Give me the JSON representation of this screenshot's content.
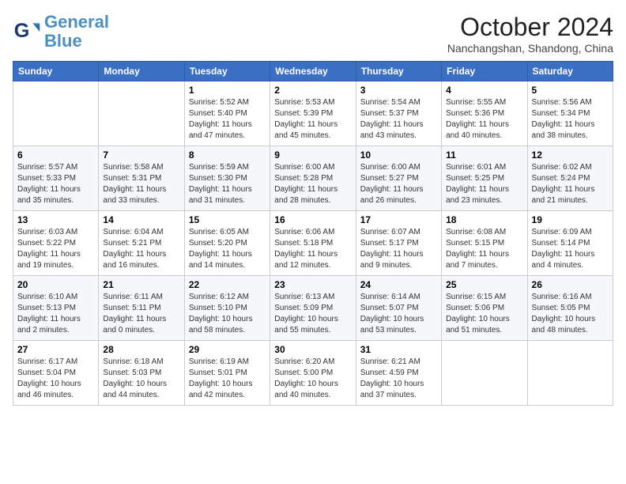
{
  "header": {
    "logo_line1": "General",
    "logo_line2": "Blue",
    "month_title": "October 2024",
    "location": "Nanchangshan, Shandong, China"
  },
  "days_of_week": [
    "Sunday",
    "Monday",
    "Tuesday",
    "Wednesday",
    "Thursday",
    "Friday",
    "Saturday"
  ],
  "weeks": [
    [
      {
        "day": "",
        "info": ""
      },
      {
        "day": "",
        "info": ""
      },
      {
        "day": "1",
        "info": "Sunrise: 5:52 AM\nSunset: 5:40 PM\nDaylight: 11 hours and 47 minutes."
      },
      {
        "day": "2",
        "info": "Sunrise: 5:53 AM\nSunset: 5:39 PM\nDaylight: 11 hours and 45 minutes."
      },
      {
        "day": "3",
        "info": "Sunrise: 5:54 AM\nSunset: 5:37 PM\nDaylight: 11 hours and 43 minutes."
      },
      {
        "day": "4",
        "info": "Sunrise: 5:55 AM\nSunset: 5:36 PM\nDaylight: 11 hours and 40 minutes."
      },
      {
        "day": "5",
        "info": "Sunrise: 5:56 AM\nSunset: 5:34 PM\nDaylight: 11 hours and 38 minutes."
      }
    ],
    [
      {
        "day": "6",
        "info": "Sunrise: 5:57 AM\nSunset: 5:33 PM\nDaylight: 11 hours and 35 minutes."
      },
      {
        "day": "7",
        "info": "Sunrise: 5:58 AM\nSunset: 5:31 PM\nDaylight: 11 hours and 33 minutes."
      },
      {
        "day": "8",
        "info": "Sunrise: 5:59 AM\nSunset: 5:30 PM\nDaylight: 11 hours and 31 minutes."
      },
      {
        "day": "9",
        "info": "Sunrise: 6:00 AM\nSunset: 5:28 PM\nDaylight: 11 hours and 28 minutes."
      },
      {
        "day": "10",
        "info": "Sunrise: 6:00 AM\nSunset: 5:27 PM\nDaylight: 11 hours and 26 minutes."
      },
      {
        "day": "11",
        "info": "Sunrise: 6:01 AM\nSunset: 5:25 PM\nDaylight: 11 hours and 23 minutes."
      },
      {
        "day": "12",
        "info": "Sunrise: 6:02 AM\nSunset: 5:24 PM\nDaylight: 11 hours and 21 minutes."
      }
    ],
    [
      {
        "day": "13",
        "info": "Sunrise: 6:03 AM\nSunset: 5:22 PM\nDaylight: 11 hours and 19 minutes."
      },
      {
        "day": "14",
        "info": "Sunrise: 6:04 AM\nSunset: 5:21 PM\nDaylight: 11 hours and 16 minutes."
      },
      {
        "day": "15",
        "info": "Sunrise: 6:05 AM\nSunset: 5:20 PM\nDaylight: 11 hours and 14 minutes."
      },
      {
        "day": "16",
        "info": "Sunrise: 6:06 AM\nSunset: 5:18 PM\nDaylight: 11 hours and 12 minutes."
      },
      {
        "day": "17",
        "info": "Sunrise: 6:07 AM\nSunset: 5:17 PM\nDaylight: 11 hours and 9 minutes."
      },
      {
        "day": "18",
        "info": "Sunrise: 6:08 AM\nSunset: 5:15 PM\nDaylight: 11 hours and 7 minutes."
      },
      {
        "day": "19",
        "info": "Sunrise: 6:09 AM\nSunset: 5:14 PM\nDaylight: 11 hours and 4 minutes."
      }
    ],
    [
      {
        "day": "20",
        "info": "Sunrise: 6:10 AM\nSunset: 5:13 PM\nDaylight: 11 hours and 2 minutes."
      },
      {
        "day": "21",
        "info": "Sunrise: 6:11 AM\nSunset: 5:11 PM\nDaylight: 11 hours and 0 minutes."
      },
      {
        "day": "22",
        "info": "Sunrise: 6:12 AM\nSunset: 5:10 PM\nDaylight: 10 hours and 58 minutes."
      },
      {
        "day": "23",
        "info": "Sunrise: 6:13 AM\nSunset: 5:09 PM\nDaylight: 10 hours and 55 minutes."
      },
      {
        "day": "24",
        "info": "Sunrise: 6:14 AM\nSunset: 5:07 PM\nDaylight: 10 hours and 53 minutes."
      },
      {
        "day": "25",
        "info": "Sunrise: 6:15 AM\nSunset: 5:06 PM\nDaylight: 10 hours and 51 minutes."
      },
      {
        "day": "26",
        "info": "Sunrise: 6:16 AM\nSunset: 5:05 PM\nDaylight: 10 hours and 48 minutes."
      }
    ],
    [
      {
        "day": "27",
        "info": "Sunrise: 6:17 AM\nSunset: 5:04 PM\nDaylight: 10 hours and 46 minutes."
      },
      {
        "day": "28",
        "info": "Sunrise: 6:18 AM\nSunset: 5:03 PM\nDaylight: 10 hours and 44 minutes."
      },
      {
        "day": "29",
        "info": "Sunrise: 6:19 AM\nSunset: 5:01 PM\nDaylight: 10 hours and 42 minutes."
      },
      {
        "day": "30",
        "info": "Sunrise: 6:20 AM\nSunset: 5:00 PM\nDaylight: 10 hours and 40 minutes."
      },
      {
        "day": "31",
        "info": "Sunrise: 6:21 AM\nSunset: 4:59 PM\nDaylight: 10 hours and 37 minutes."
      },
      {
        "day": "",
        "info": ""
      },
      {
        "day": "",
        "info": ""
      }
    ]
  ]
}
